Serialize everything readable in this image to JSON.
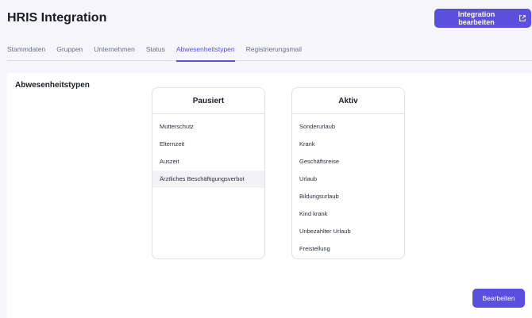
{
  "header": {
    "title": "HRIS Integration",
    "edit_button_label": "Integration bearbeiten",
    "edit_button_icon": "external-link-icon"
  },
  "tabs": [
    {
      "label": "Stammdaten",
      "active": false
    },
    {
      "label": "Gruppen",
      "active": false
    },
    {
      "label": "Unternehmen",
      "active": false
    },
    {
      "label": "Status",
      "active": false
    },
    {
      "label": "Abwesenheitstypen",
      "active": true
    },
    {
      "label": "Registrierungsmail",
      "active": false
    }
  ],
  "section": {
    "title": "Abwesenheitstypen",
    "paused": {
      "title": "Pausiert",
      "items": [
        "Mutterschutz",
        "Elternzeit",
        "Auszeit",
        "Ärztliches Beschäftigungsverbot"
      ]
    },
    "active": {
      "title": "Aktiv",
      "items": [
        "Sonderurlaub",
        "Krank",
        "Geschäftsreise",
        "Urlaub",
        "Bildungsurlaub",
        "Kind krank",
        "Unbezahlter Urlaub",
        "Freistellung"
      ]
    },
    "save_button_label": "Bearbeiten"
  },
  "colors": {
    "accent": "#5b4fe0",
    "background": "#f5f5fa"
  }
}
